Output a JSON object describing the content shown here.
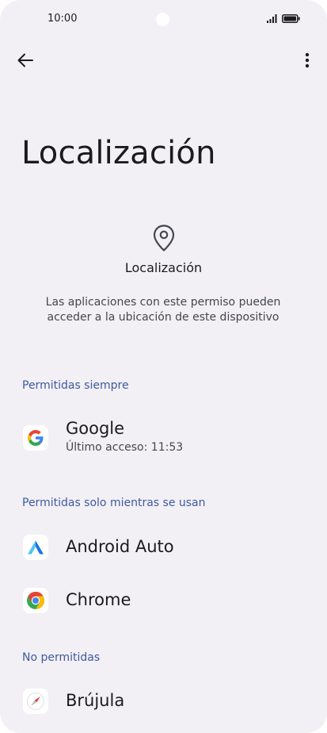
{
  "status_bar": {
    "time": "10:00"
  },
  "toolbar": {
    "back_icon": "arrow-left-icon",
    "menu_icon": "more-vert-icon"
  },
  "page": {
    "title": "Localización"
  },
  "permission": {
    "icon": "location-pin-icon",
    "name": "Localización",
    "description": "Las aplicaciones con este permiso pueden acceder a la ubicación de este dispositivo"
  },
  "sections": {
    "always": {
      "label": "Permitidas siempre",
      "apps": [
        {
          "name": "Google",
          "subtitle": "Último acceso: 11:53",
          "icon": "google-icon"
        }
      ]
    },
    "while_in_use": {
      "label": "Permitidas solo mientras se usan",
      "apps": [
        {
          "name": "Android Auto",
          "icon": "android-auto-icon"
        },
        {
          "name": "Chrome",
          "icon": "chrome-icon"
        }
      ]
    },
    "denied": {
      "label": "No permitidas",
      "apps": [
        {
          "name": "Brújula",
          "icon": "compass-icon"
        }
      ]
    }
  },
  "colors": {
    "background": "#f2f0f5",
    "section_label": "#3f5aa0",
    "text_primary": "#1b1b1f",
    "text_secondary": "#45464f"
  }
}
